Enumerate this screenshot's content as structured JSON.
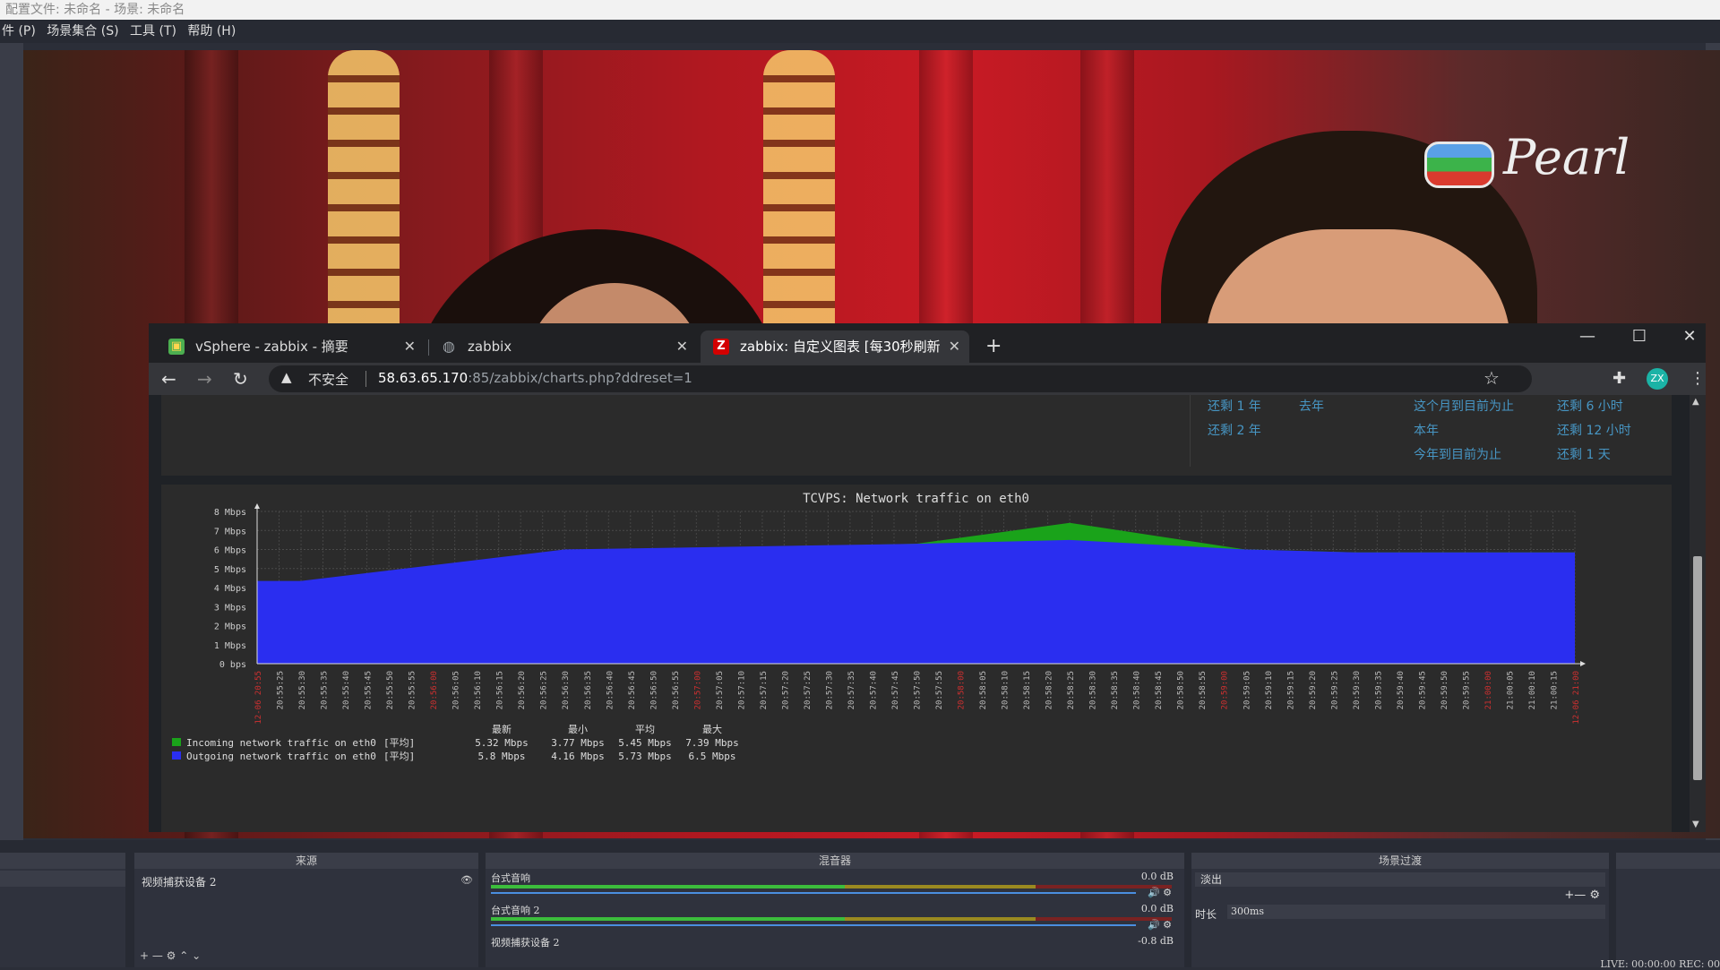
{
  "app": {
    "title": "配置文件: 未命名 - 场景: 未命名",
    "menu": [
      "件 (P)",
      "场景集合 (S)",
      "工具 (T)",
      "帮助 (H)"
    ]
  },
  "preview": {
    "logo_text": "Pearl"
  },
  "browser": {
    "tabs": [
      {
        "label": "vSphere - zabbix - 摘要",
        "icon": "vsphere-icon",
        "active": false
      },
      {
        "label": "zabbix",
        "icon": "globe-icon",
        "active": false
      },
      {
        "label": "zabbix: 自定义图表 [每30秒刷新",
        "icon": "zabbix-z-icon",
        "active": true
      }
    ],
    "new_tab": "+",
    "window_controls": {
      "minimize": "—",
      "maximize": "☐",
      "close": "✕"
    },
    "nav": {
      "back": "←",
      "forward": "→",
      "reload": "↻"
    },
    "address": {
      "security_label": "不安全",
      "host": "58.63.65.170",
      "rest": ":85/zabbix/charts.php?ddreset=1"
    },
    "avatar": "ZX"
  },
  "time_filter": {
    "links": [
      "还剩 1 年",
      "去年",
      "这个月到目前为止",
      "还剩 6 小时",
      "还剩 2 年",
      "本年",
      "还剩 12 小时",
      "今年到目前为止",
      "还剩 1 天"
    ]
  },
  "chart_data": {
    "type": "area",
    "title": "TCVPS: Network traffic on eth0",
    "ylabel": "",
    "y_ticks": [
      "8 Mbps",
      "7 Mbps",
      "6 Mbps",
      "5 Mbps",
      "4 Mbps",
      "3 Mbps",
      "2 Mbps",
      "1 Mbps",
      "0 bps"
    ],
    "ylim": [
      0,
      8
    ],
    "x_ticks": [
      "12-06 20:55",
      "20:55:25",
      "20:55:30",
      "20:55:35",
      "20:55:40",
      "20:55:45",
      "20:55:50",
      "20:55:55",
      "20:56:00",
      "20:56:05",
      "20:56:10",
      "20:56:15",
      "20:56:20",
      "20:56:25",
      "20:56:30",
      "20:56:35",
      "20:56:40",
      "20:56:45",
      "20:56:50",
      "20:56:55",
      "20:57:00",
      "20:57:05",
      "20:57:10",
      "20:57:15",
      "20:57:20",
      "20:57:25",
      "20:57:30",
      "20:57:35",
      "20:57:40",
      "20:57:45",
      "20:57:50",
      "20:57:55",
      "20:58:00",
      "20:58:05",
      "20:58:10",
      "20:58:15",
      "20:58:20",
      "20:58:25",
      "20:58:30",
      "20:58:35",
      "20:58:40",
      "20:58:45",
      "20:58:50",
      "20:58:55",
      "20:59:00",
      "20:59:05",
      "20:59:10",
      "20:59:15",
      "20:59:20",
      "20:59:25",
      "20:59:30",
      "20:59:35",
      "20:59:40",
      "20:59:45",
      "20:59:50",
      "20:59:55",
      "21:00:00",
      "21:00:05",
      "21:00:10",
      "21:00:15",
      "12-06 21:00"
    ],
    "x_ticks_red": [
      0,
      8,
      20,
      32,
      44,
      56,
      60
    ],
    "series": [
      {
        "name": "Incoming network traffic on eth0",
        "color": "#1aa31a",
        "points": [
          [
            0,
            4.1
          ],
          [
            2,
            4.1
          ],
          [
            14,
            5.9
          ],
          [
            30,
            6.3
          ],
          [
            37,
            7.4
          ],
          [
            45,
            6.0
          ],
          [
            50,
            5.85
          ],
          [
            60,
            5.85
          ]
        ]
      },
      {
        "name": "Outgoing network traffic on eth0",
        "color": "#2a2ef0",
        "points": [
          [
            0,
            4.35
          ],
          [
            2,
            4.35
          ],
          [
            14,
            6.0
          ],
          [
            30,
            6.3
          ],
          [
            37,
            6.5
          ],
          [
            45,
            6.0
          ],
          [
            50,
            5.85
          ],
          [
            60,
            5.85
          ]
        ]
      }
    ],
    "legend": {
      "headers": [
        "最新",
        "最小",
        "平均",
        "最大"
      ],
      "rows": [
        {
          "name": "Incoming network traffic on eth0",
          "func": "[平均]",
          "last": "5.32 Mbps",
          "min": "3.77 Mbps",
          "avg": "5.45 Mbps",
          "max": "7.39 Mbps",
          "color": "#1aa31a"
        },
        {
          "name": "Outgoing network traffic on eth0",
          "func": "[平均]",
          "last": "5.8 Mbps",
          "min": "4.16 Mbps",
          "avg": "5.73 Mbps",
          "max": "6.5 Mbps",
          "color": "#2a2ef0"
        }
      ]
    },
    "grid": true
  },
  "dock": {
    "sources_title": "来源",
    "mixer_title": "混音器",
    "transition_title": "场景过渡",
    "source_item": "视频捕获设备 2",
    "source_controls": "+ — ⚙   ⌃ ⌄",
    "mixer": [
      {
        "name": "台式音响",
        "db": "0.0 dB"
      },
      {
        "name": "台式音响 2",
        "db": "0.0 dB"
      },
      {
        "name": "视频捕获设备 2",
        "db": "-0.8 dB"
      }
    ],
    "transition": {
      "type": "淡出",
      "duration_label": "时长",
      "duration": "300ms"
    },
    "status": "LIVE: 00:00:00   REC: 00"
  }
}
